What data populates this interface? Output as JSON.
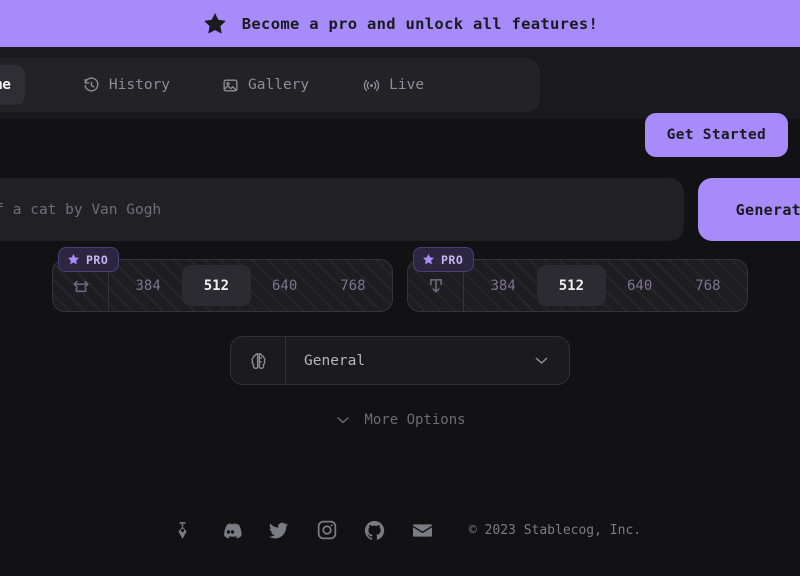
{
  "banner": {
    "text": "Become a pro and unlock all features!",
    "icon": "star-icon",
    "bg_color": "#a78bfa",
    "text_color": "#1b1b1f"
  },
  "nav": {
    "items": [
      {
        "label": "Home",
        "icon": "home-icon",
        "active": true
      },
      {
        "label": "History",
        "icon": "clock-icon",
        "active": false
      },
      {
        "label": "Gallery",
        "icon": "image-icon",
        "active": false
      },
      {
        "label": "Live",
        "icon": "broadcast-icon",
        "active": false
      }
    ],
    "get_started_label": "Get Started"
  },
  "prompt": {
    "placeholder": "Portrait of a cat by Van Gogh",
    "value": "",
    "generate_label": "Generate"
  },
  "dimensions": {
    "pro_badge_label": "PRO",
    "pro_badge_icon": "star-icon",
    "width": {
      "icon": "width-icon",
      "options": [
        "384",
        "512",
        "640",
        "768"
      ],
      "selected": "512"
    },
    "height": {
      "icon": "height-icon",
      "options": [
        "384",
        "512",
        "640",
        "768"
      ],
      "selected": "512"
    }
  },
  "model": {
    "icon": "brain-icon",
    "selected": "General",
    "chevron": "chevron-down-icon"
  },
  "more_options": {
    "label": "More Options",
    "icon": "chevron-down-icon"
  },
  "footer": {
    "socials": [
      {
        "name": "stablecog-pen-icon"
      },
      {
        "name": "discord-icon"
      },
      {
        "name": "twitter-icon"
      },
      {
        "name": "instagram-icon"
      },
      {
        "name": "github-icon"
      },
      {
        "name": "email-icon"
      }
    ],
    "copyright": "© 2023 Stablecog, Inc."
  },
  "theme": {
    "accent": "#a78bfa",
    "background": "#121214",
    "surface": "#1a1a1e",
    "surface_alt": "#212125"
  }
}
